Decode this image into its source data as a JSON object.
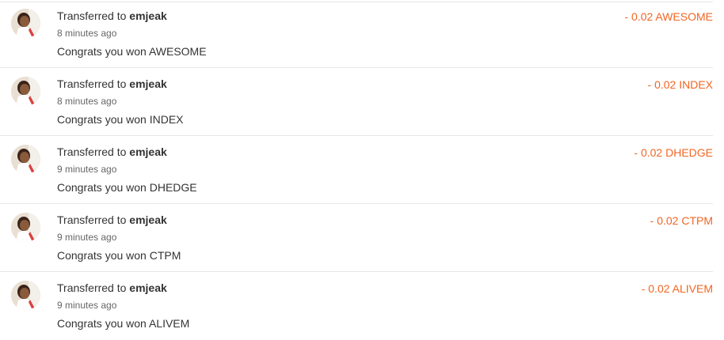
{
  "colors": {
    "amount": "#f26522",
    "divider": "#e6e6e6",
    "text": "#333333",
    "muted": "#666666"
  },
  "transactions": [
    {
      "action": "Transferred to ",
      "user": "emjeak",
      "time": "8 minutes ago",
      "memo": "Congrats you won AWESOME",
      "amount": "- 0.02 AWESOME",
      "avatar_icon": "user-avatar-icon"
    },
    {
      "action": "Transferred to ",
      "user": "emjeak",
      "time": "8 minutes ago",
      "memo": "Congrats you won INDEX",
      "amount": "- 0.02 INDEX",
      "avatar_icon": "user-avatar-icon"
    },
    {
      "action": "Transferred to ",
      "user": "emjeak",
      "time": "9 minutes ago",
      "memo": "Congrats you won DHEDGE",
      "amount": "- 0.02 DHEDGE",
      "avatar_icon": "user-avatar-icon"
    },
    {
      "action": "Transferred to ",
      "user": "emjeak",
      "time": "9 minutes ago",
      "memo": "Congrats you won CTPM",
      "amount": "- 0.02 CTPM",
      "avatar_icon": "user-avatar-icon"
    },
    {
      "action": "Transferred to ",
      "user": "emjeak",
      "time": "9 minutes ago",
      "memo": "Congrats you won ALIVEM",
      "amount": "- 0.02 ALIVEM",
      "avatar_icon": "user-avatar-icon"
    }
  ]
}
